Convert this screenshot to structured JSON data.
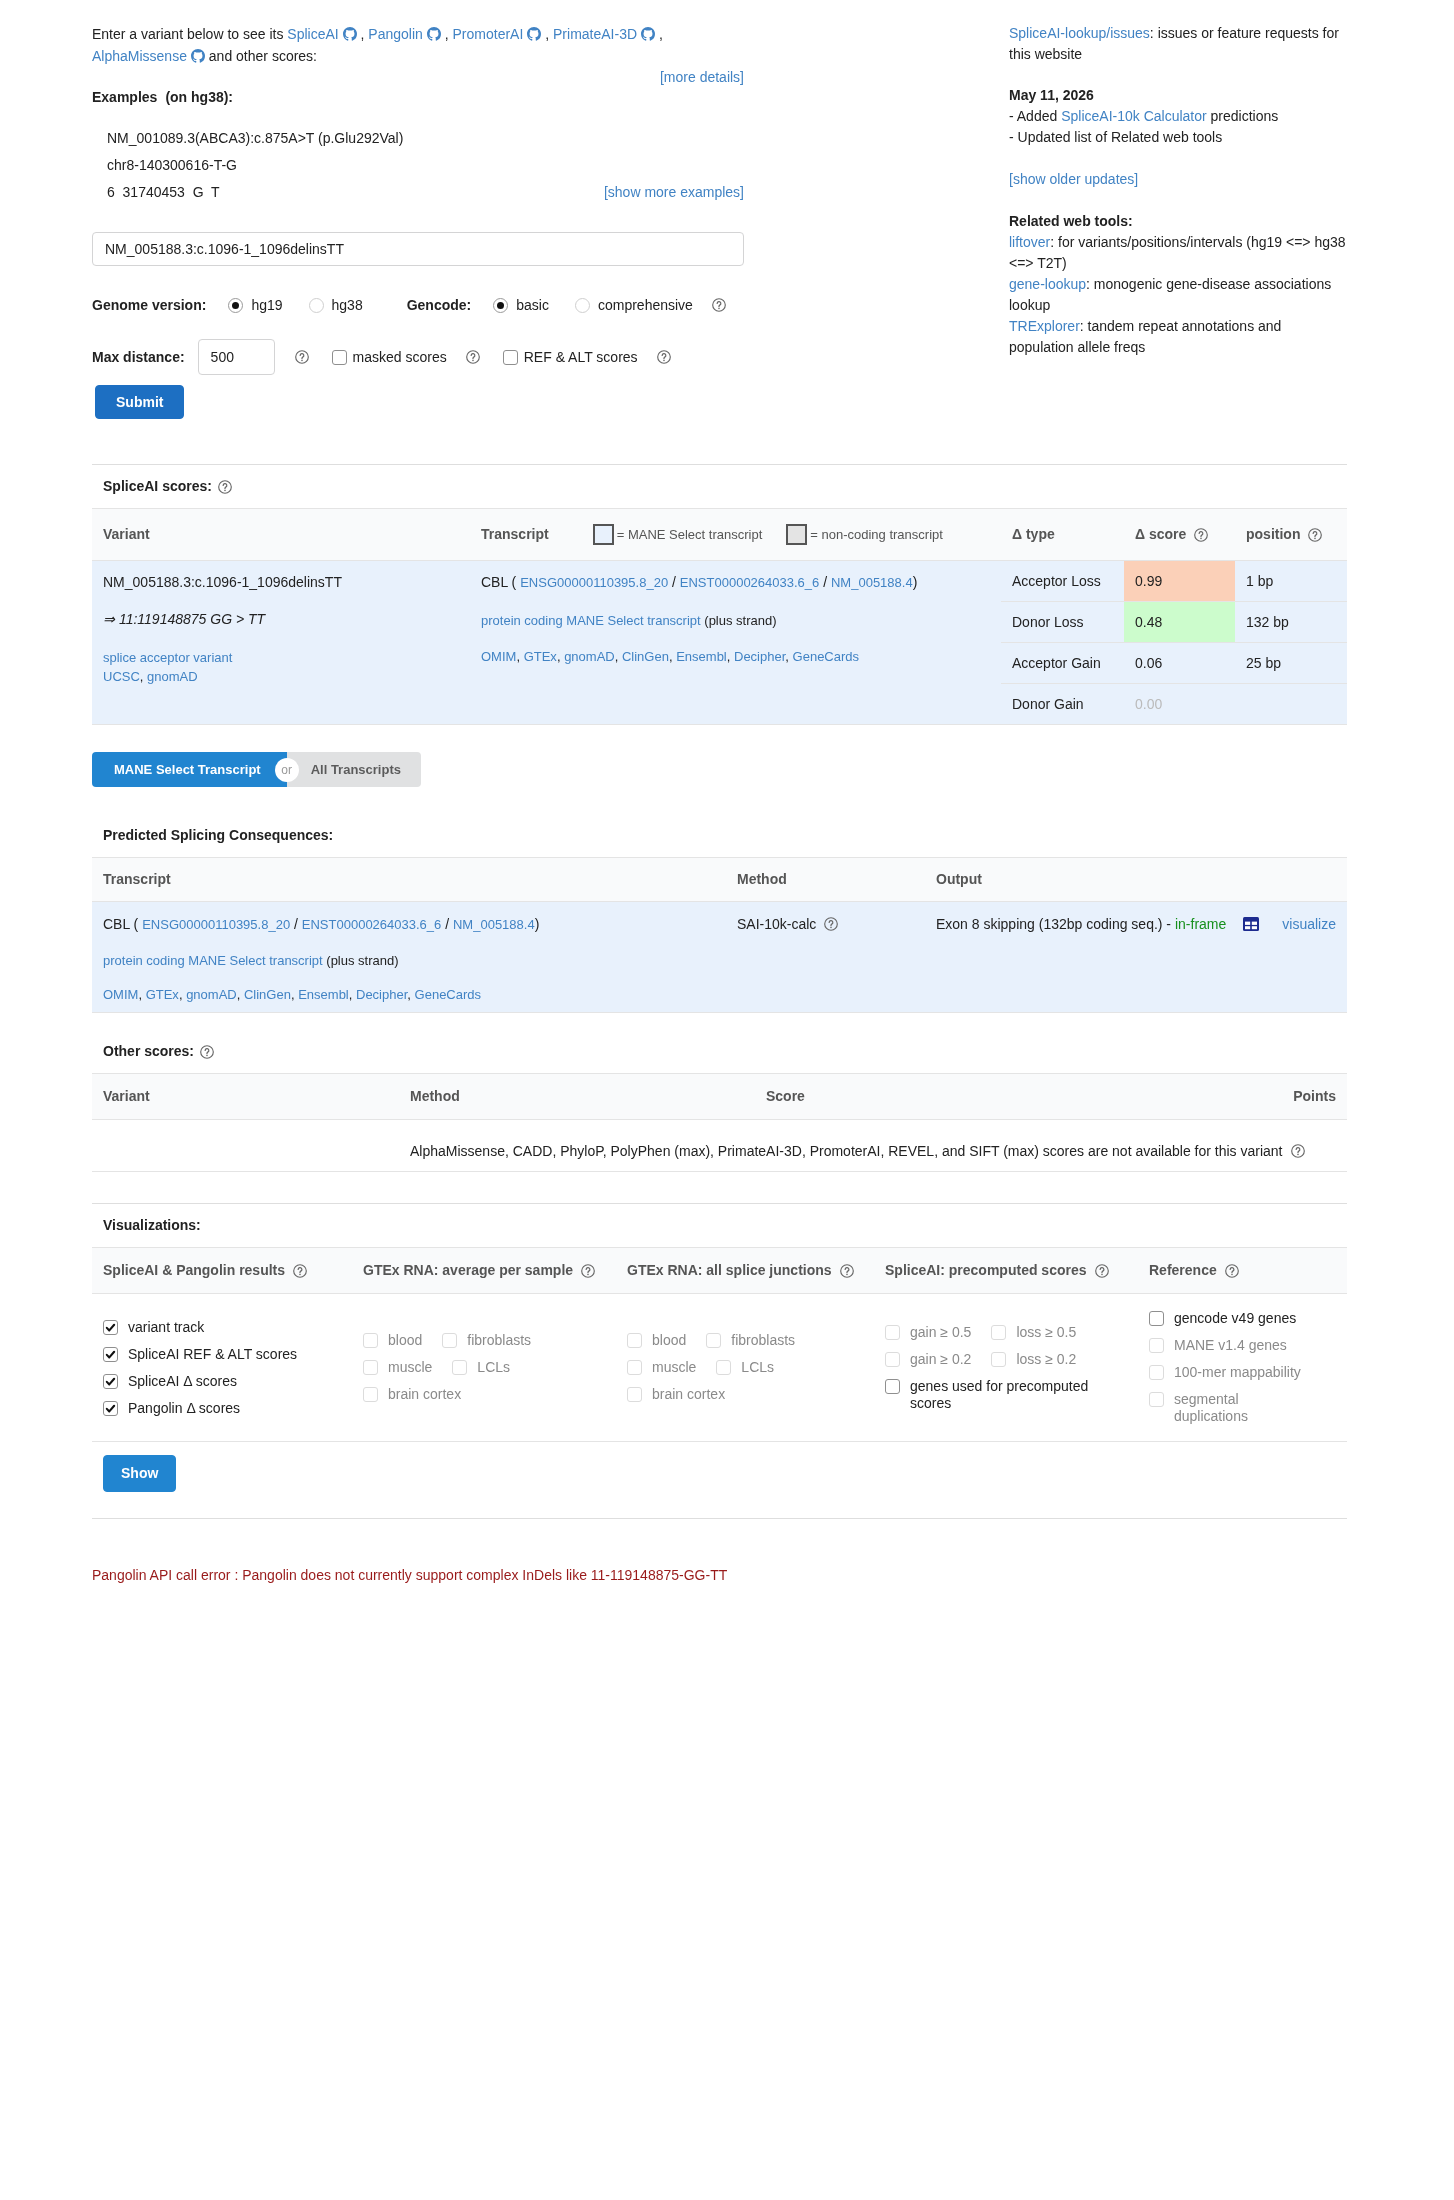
{
  "intro": {
    "segments": [
      {
        "kind": "text",
        "text": "Enter a variant below to see its"
      },
      {
        "kind": "repo_link",
        "text": "SpliceAI"
      },
      {
        "kind": "text",
        "text": ","
      },
      {
        "kind": "repo_link",
        "text": "Pangolin"
      },
      {
        "kind": "text",
        "text": ","
      },
      {
        "kind": "repo_link",
        "text": "PromoterAI"
      },
      {
        "kind": "text",
        "text": ","
      },
      {
        "kind": "repo_link",
        "text": "PrimateAI-3D"
      },
      {
        "kind": "text",
        "text": ","
      },
      {
        "kind": "repo_link",
        "text": "AlphaMissense"
      },
      {
        "kind": "text",
        "text": "and other scores:"
      }
    ],
    "more_link": "[more details]"
  },
  "examples": {
    "title": "Examples",
    "note": "(on hg38):",
    "items": [
      "NM_001089.3(ABCA3):c.875A>T (p.Glu292Val)",
      "chr8-140300616-T-G",
      "6  31740453  G  T"
    ],
    "more_link": "[show more examples]"
  },
  "form": {
    "variant_input": {
      "value": "NM_005188.3:c.1096-1_1096delinsTT"
    },
    "genome": {
      "label": "Genome version:",
      "options": [
        {
          "label": "hg19",
          "selected": true
        },
        {
          "label": "hg38",
          "selected": false
        }
      ],
      "help": false
    },
    "gencode": {
      "label": "Gencode:",
      "options": [
        {
          "label": "basic",
          "selected": true
        },
        {
          "label": "comprehensive",
          "selected": false
        }
      ],
      "help": true
    },
    "max_distance": {
      "label": "Max distance:",
      "value": "500",
      "help": true
    },
    "checkboxes": [
      {
        "label": "masked scores",
        "checked": false,
        "help": true
      },
      {
        "label": "REF & ALT scores",
        "checked": false,
        "help": true
      }
    ],
    "submit": "Submit"
  },
  "sidebar": {
    "issues": {
      "segments": [
        {
          "kind": "link",
          "text": "SpliceAI-lookup/issues"
        },
        {
          "kind": "punct",
          "text": ": issues or feature requests for this website"
        }
      ]
    },
    "news": {
      "date": "May 11, 2026",
      "items": [
        {
          "segments": [
            {
              "kind": "text",
              "text": "- Added"
            },
            {
              "kind": "link",
              "text": "SpliceAI-10k Calculator"
            },
            {
              "kind": "text",
              "text": "predictions"
            }
          ]
        },
        {
          "segments": [
            {
              "kind": "text",
              "text": "- Updated list of Related web tools"
            }
          ]
        }
      ],
      "older_link": "[show older updates]"
    },
    "related": {
      "title": "Related web tools:",
      "items": [
        {
          "segments": [
            {
              "kind": "link",
              "text": "liftover"
            },
            {
              "kind": "punct",
              "text": ": for variants/positions/intervals (hg19 <=> hg38 <=> T2T)"
            }
          ]
        },
        {
          "segments": [
            {
              "kind": "link",
              "text": "gene-lookup"
            },
            {
              "kind": "punct",
              "text": ": monogenic gene-disease associations lookup"
            }
          ]
        },
        {
          "segments": [
            {
              "kind": "link",
              "text": "TRExplorer"
            },
            {
              "kind": "punct",
              "text": ": tandem repeat annotations and population allele freqs"
            }
          ]
        }
      ]
    }
  },
  "splice_scores": {
    "title": "SpliceAI scores:",
    "help": true,
    "columns": [
      {
        "label": "Variant",
        "help": false
      },
      {
        "label": "Transcript",
        "help": false,
        "legend": [
          {
            "label": "= MANE Select transcript",
            "color": "#e8f1fc"
          },
          {
            "label": "= non-coding transcript",
            "color": "#e4e4e4"
          }
        ]
      },
      {
        "label": "Δ type",
        "help": false
      },
      {
        "label": "Δ score",
        "help": true
      },
      {
        "label": "position",
        "help": true
      }
    ],
    "rows": [
      {
        "mane_select": true,
        "variant": {
          "id": "NM_005188.3:c.1096-1_1096delinsTT",
          "normalized": "⇒ 11:119148875 GG > TT",
          "consequence": "splice acceptor variant",
          "links": [
            {
              "kind": "link",
              "text": "UCSC"
            },
            {
              "kind": "punct",
              "text": ","
            },
            {
              "kind": "link",
              "text": "gnomAD"
            }
          ]
        },
        "transcript": {
          "lines": [
            {
              "segments": [
                {
                  "kind": "text",
                  "text": "CBL  ("
                },
                {
                  "kind": "link",
                  "text": "ENSG00000110395.8_20"
                },
                {
                  "kind": "text",
                  "text": "/"
                },
                {
                  "kind": "link",
                  "text": "ENST00000264033.6_6"
                },
                {
                  "kind": "text",
                  "text": "/"
                },
                {
                  "kind": "link",
                  "text": "NM_005188.4"
                },
                {
                  "kind": "punct",
                  "text": ")"
                }
              ]
            },
            {
              "segments": [
                {
                  "kind": "link",
                  "text": "protein coding"
                },
                {
                  "kind": "link",
                  "text": "MANE Select transcript"
                },
                {
                  "kind": "text",
                  "text": "(plus strand)"
                }
              ]
            },
            {
              "segments": [
                {
                  "kind": "link",
                  "text": "OMIM"
                },
                {
                  "kind": "punct",
                  "text": ","
                },
                {
                  "kind": "link",
                  "text": "GTEx"
                },
                {
                  "kind": "punct",
                  "text": ","
                },
                {
                  "kind": "link",
                  "text": "gnomAD"
                },
                {
                  "kind": "punct",
                  "text": ","
                },
                {
                  "kind": "link",
                  "text": "ClinGen"
                },
                {
                  "kind": "punct",
                  "text": ","
                },
                {
                  "kind": "link",
                  "text": "Ensembl"
                },
                {
                  "kind": "punct",
                  "text": ","
                },
                {
                  "kind": "link",
                  "text": "Decipher"
                },
                {
                  "kind": "punct",
                  "text": ","
                },
                {
                  "kind": "link",
                  "text": "GeneCards"
                }
              ]
            }
          ]
        },
        "scores": [
          {
            "type": "Acceptor Loss",
            "score": "0.99",
            "position": "1 bp",
            "color": "#fbd0b8",
            "muted": false
          },
          {
            "type": "Donor Loss",
            "score": "0.48",
            "position": "132 bp",
            "color": "#ccfccc",
            "muted": false
          },
          {
            "type": "Acceptor Gain",
            "score": "0.06",
            "position": "25 bp",
            "muted": false
          },
          {
            "type": "Donor Gain",
            "score": "0.00",
            "muted": true
          }
        ]
      }
    ]
  },
  "transcript_filter": {
    "options": [
      {
        "label": "MANE Select Transcript",
        "selected": true
      },
      {
        "label": "All Transcripts",
        "selected": false
      }
    ],
    "separator": "or"
  },
  "consequences": {
    "title": "Predicted Splicing Consequences:",
    "columns": [
      {
        "label": "Transcript"
      },
      {
        "label": "Method"
      },
      {
        "label": "Output"
      }
    ],
    "rows": [
      {
        "mane_select": true,
        "transcript": {
          "lines": [
            {
              "segments": [
                {
                  "kind": "text",
                  "text": "CBL  ("
                },
                {
                  "kind": "link",
                  "text": "ENSG00000110395.8_20"
                },
                {
                  "kind": "text",
                  "text": "/"
                },
                {
                  "kind": "link",
                  "text": "ENST00000264033.6_6"
                },
                {
                  "kind": "text",
                  "text": "/"
                },
                {
                  "kind": "link",
                  "text": "NM_005188.4"
                },
                {
                  "kind": "punct",
                  "text": ")"
                }
              ]
            },
            {
              "segments": [
                {
                  "kind": "link",
                  "text": "protein coding"
                },
                {
                  "kind": "link",
                  "text": "MANE Select transcript"
                },
                {
                  "kind": "text",
                  "text": "(plus strand)"
                }
              ]
            },
            {
              "segments": [
                {
                  "kind": "link",
                  "text": "OMIM"
                },
                {
                  "kind": "punct",
                  "text": ","
                },
                {
                  "kind": "link",
                  "text": "GTEx"
                },
                {
                  "kind": "punct",
                  "text": ","
                },
                {
                  "kind": "link",
                  "text": "gnomAD"
                },
                {
                  "kind": "punct",
                  "text": ","
                },
                {
                  "kind": "link",
                  "text": "ClinGen"
                },
                {
                  "kind": "punct",
                  "text": ","
                },
                {
                  "kind": "link",
                  "text": "Ensembl"
                },
                {
                  "kind": "punct",
                  "text": ","
                },
                {
                  "kind": "link",
                  "text": "Decipher"
                },
                {
                  "kind": "punct",
                  "text": ","
                },
                {
                  "kind": "link",
                  "text": "GeneCards"
                }
              ]
            }
          ]
        },
        "method": "SAI-10k-calc",
        "method_help": true,
        "output": {
          "segments": [
            {
              "kind": "text",
              "text": "Exon 8 skipping (132bp coding seq.) -"
            },
            {
              "kind": "positive",
              "text": "in-frame"
            }
          ],
          "link": "visualize"
        }
      }
    ]
  },
  "other_scores": {
    "title": "Other scores:",
    "help": true,
    "columns": [
      {
        "label": "Variant"
      },
      {
        "label": "Method"
      },
      {
        "label": "Score"
      },
      {
        "label": "Points"
      }
    ],
    "rows": [
      {
        "message": "AlphaMissense, CADD, PhyloP, PolyPhen (max), PrimateAI-3D, PromoterAI, REVEL, and SIFT (max) scores are not available for this variant",
        "help": true
      }
    ]
  },
  "visualizations": {
    "title": "Visualizations:",
    "groups": [
      {
        "label": "SpliceAI & Pangolin results",
        "help": true,
        "option_lines": [
          [
            {
              "label": "variant track",
              "checked": true,
              "disabled": false
            }
          ],
          [
            {
              "label": "SpliceAI REF & ALT scores",
              "checked": true,
              "disabled": false
            }
          ],
          [
            {
              "label": "SpliceAI Δ scores",
              "checked": true,
              "disabled": false
            }
          ],
          [
            {
              "label": "Pangolin Δ scores",
              "checked": true,
              "disabled": false
            }
          ]
        ]
      },
      {
        "label": "GTEx RNA: average per sample",
        "help": true,
        "option_lines": [
          [
            {
              "label": "blood",
              "checked": false,
              "disabled": true
            },
            {
              "label": "fibroblasts",
              "checked": false,
              "disabled": true
            }
          ],
          [
            {
              "label": "muscle",
              "checked": false,
              "disabled": true
            },
            {
              "label": "LCLs",
              "checked": false,
              "disabled": true
            }
          ],
          [
            {
              "label": "brain cortex",
              "checked": false,
              "disabled": true
            }
          ]
        ]
      },
      {
        "label": "GTEx RNA: all splice junctions",
        "help": true,
        "option_lines": [
          [
            {
              "label": "blood",
              "checked": false,
              "disabled": true
            },
            {
              "label": "fibroblasts",
              "checked": false,
              "disabled": true
            }
          ],
          [
            {
              "label": "muscle",
              "checked": false,
              "disabled": true
            },
            {
              "label": "LCLs",
              "checked": false,
              "disabled": true
            }
          ],
          [
            {
              "label": "brain cortex",
              "checked": false,
              "disabled": true
            }
          ]
        ]
      },
      {
        "label": "SpliceAI: precomputed scores",
        "help": true,
        "option_lines": [
          [
            {
              "label": "gain ≥ 0.5",
              "checked": false,
              "disabled": true
            },
            {
              "label": "loss ≥ 0.5",
              "checked": false,
              "disabled": true
            }
          ],
          [
            {
              "label": "gain ≥ 0.2",
              "checked": false,
              "disabled": true
            },
            {
              "label": "loss ≥ 0.2",
              "checked": false,
              "disabled": true
            }
          ],
          [
            {
              "label": "genes used for precomputed scores",
              "checked": false,
              "disabled": false
            }
          ]
        ]
      },
      {
        "label": "Reference",
        "help": true,
        "option_lines": [
          [
            {
              "label": "gencode v49 genes",
              "checked": false,
              "disabled": false
            }
          ],
          [
            {
              "label": "MANE v1.4 genes",
              "checked": false,
              "disabled": true
            }
          ],
          [
            {
              "label": "100-mer mappability",
              "checked": false,
              "disabled": true
            }
          ],
          [
            {
              "label": "segmental duplications",
              "checked": false,
              "disabled": true
            }
          ]
        ]
      }
    ],
    "show_button": "Show"
  },
  "error": "Pangolin API call error : Pangolin does not currently support complex InDels like 11-119148875-GG-TT"
}
